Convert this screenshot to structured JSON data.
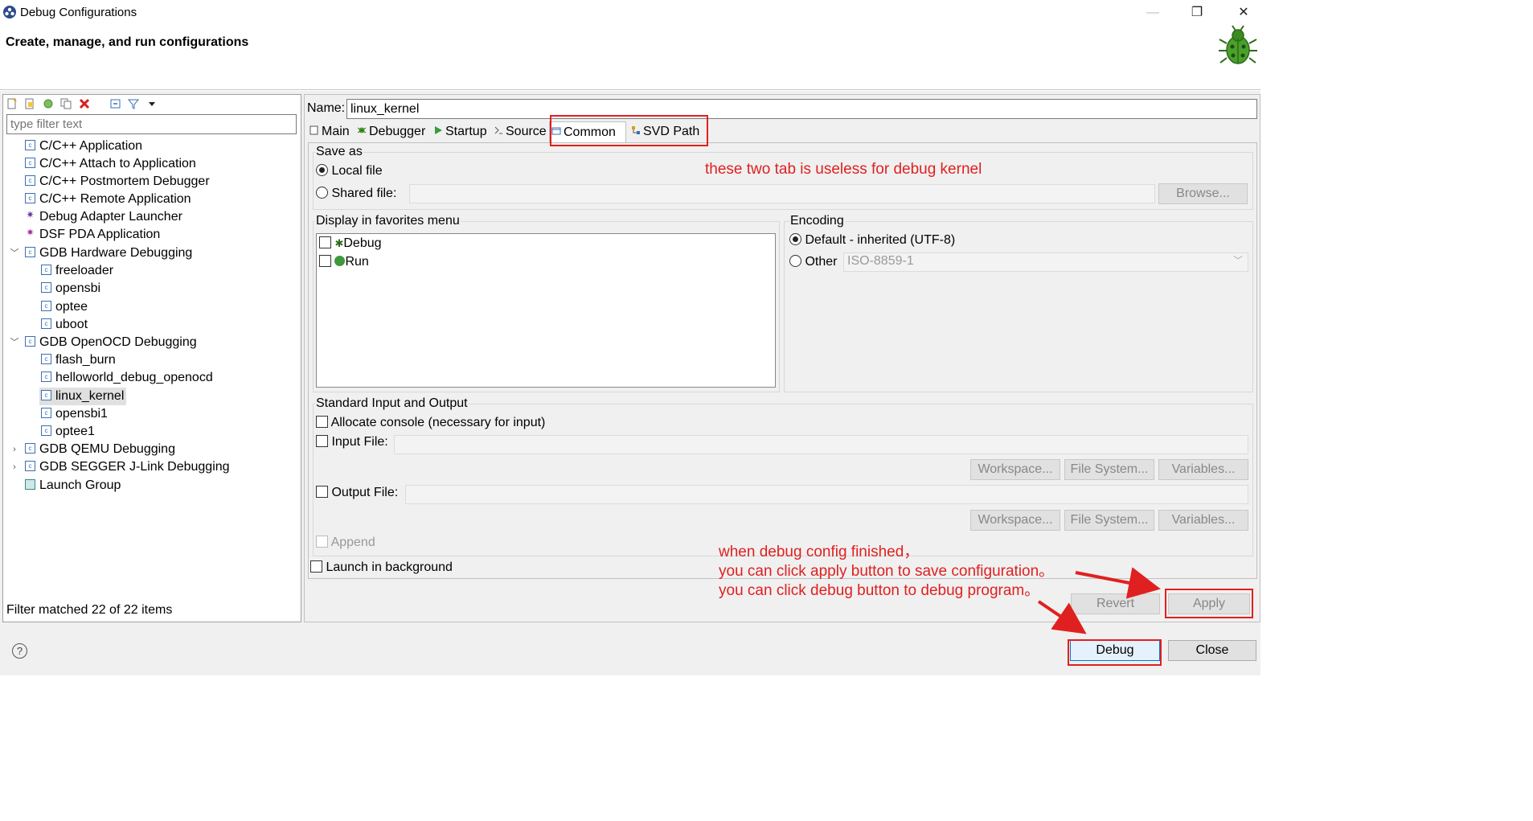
{
  "window": {
    "title": "Debug Configurations",
    "minimize": "—",
    "restore": "❐",
    "close": "✕"
  },
  "header": {
    "title": "Create, manage, and run configurations"
  },
  "left": {
    "filter_placeholder": "type filter text",
    "tree": [
      {
        "label": "C/C++ Application"
      },
      {
        "label": "C/C++ Attach to Application"
      },
      {
        "label": "C/C++ Postmortem Debugger"
      },
      {
        "label": "C/C++ Remote Application"
      },
      {
        "label": "Debug Adapter Launcher"
      },
      {
        "label": "DSF PDA Application"
      },
      {
        "label": "GDB Hardware Debugging"
      },
      {
        "label": "freeloader"
      },
      {
        "label": "opensbi"
      },
      {
        "label": "optee"
      },
      {
        "label": "uboot"
      },
      {
        "label": "GDB OpenOCD Debugging"
      },
      {
        "label": "flash_burn"
      },
      {
        "label": "helloworld_debug_openocd"
      },
      {
        "label": "linux_kernel"
      },
      {
        "label": "opensbi1"
      },
      {
        "label": "optee1"
      },
      {
        "label": "GDB QEMU Debugging"
      },
      {
        "label": "GDB SEGGER J-Link Debugging"
      },
      {
        "label": "Launch Group"
      }
    ],
    "filter_status": "Filter matched 22 of 22 items"
  },
  "config": {
    "name_label": "Name:",
    "name_value": "linux_kernel",
    "tabs": [
      "Main",
      "Debugger",
      "Startup",
      "Source",
      "Common",
      "SVD Path"
    ],
    "active_tab": "Common",
    "save_as": {
      "label": "Save as",
      "local_file": "Local file",
      "shared_file": "Shared file:",
      "browse": "Browse..."
    },
    "favorites": {
      "label": "Display in favorites menu",
      "items": [
        "Debug",
        "Run"
      ]
    },
    "encoding": {
      "label": "Encoding",
      "default": "Default - inherited (UTF-8)",
      "other": "Other",
      "other_value": "ISO-8859-1"
    },
    "std_io": {
      "label": "Standard Input and Output",
      "allocate_console": "Allocate console (necessary for input)",
      "input_file": "Input File:",
      "output_file": "Output File:",
      "workspace": "Workspace...",
      "file_system": "File System...",
      "variables": "Variables...",
      "append": "Append"
    },
    "launch_background": "Launch in background",
    "revert": "Revert",
    "apply": "Apply"
  },
  "footer": {
    "help": "?",
    "debug": "Debug",
    "close": "Close"
  },
  "annotations": {
    "tabs_note": "these two tab is useless for debug kernel",
    "line1": "when debug config finished，",
    "line2": "you can click apply button to save configuration。",
    "line3": "you can click debug button to debug program。"
  },
  "colors": {
    "annotation_red": "#e02020",
    "window_bg": "#f0f0f0"
  }
}
